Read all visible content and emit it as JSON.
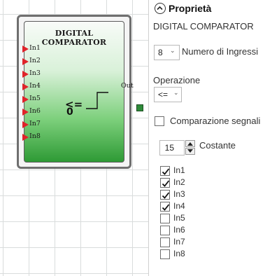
{
  "canvas": {
    "block": {
      "title": "DIGITAL COMPARATOR",
      "inputs": [
        "In1",
        "In2",
        "In3",
        "In4",
        "In5",
        "In6",
        "In7",
        "In8"
      ],
      "operator_symbol": "<=",
      "constant_display": "0",
      "output_label": "Out"
    }
  },
  "panel": {
    "title": "Proprietà",
    "block_name": "DIGITAL COMPARATOR",
    "num_inputs_value": "8",
    "num_inputs_label": "Numero di Ingressi",
    "operation_label": "Operazione",
    "operation_value": "<=",
    "compare_signals_label": "Comparazione segnali",
    "compare_signals_checked": false,
    "constant_value": "15",
    "constant_label": "Costante",
    "inputs": [
      {
        "label": "In1",
        "checked": true
      },
      {
        "label": "In2",
        "checked": true
      },
      {
        "label": "In3",
        "checked": true
      },
      {
        "label": "In4",
        "checked": true
      },
      {
        "label": "In5",
        "checked": false
      },
      {
        "label": "In6",
        "checked": false
      },
      {
        "label": "In7",
        "checked": false
      },
      {
        "label": "In8",
        "checked": false
      }
    ]
  },
  "colors": {
    "pin_arrow": "#e0232a",
    "block_gradient_bottom": "#2e9a35",
    "output_pin": "#2e8b3a"
  },
  "icons": [
    "collapse-chevron-up-icon",
    "dropdown-chevron-icon",
    "checkmark-icon",
    "spin-up-icon",
    "spin-down-icon",
    "input-arrow-icon",
    "step-signal-icon"
  ]
}
